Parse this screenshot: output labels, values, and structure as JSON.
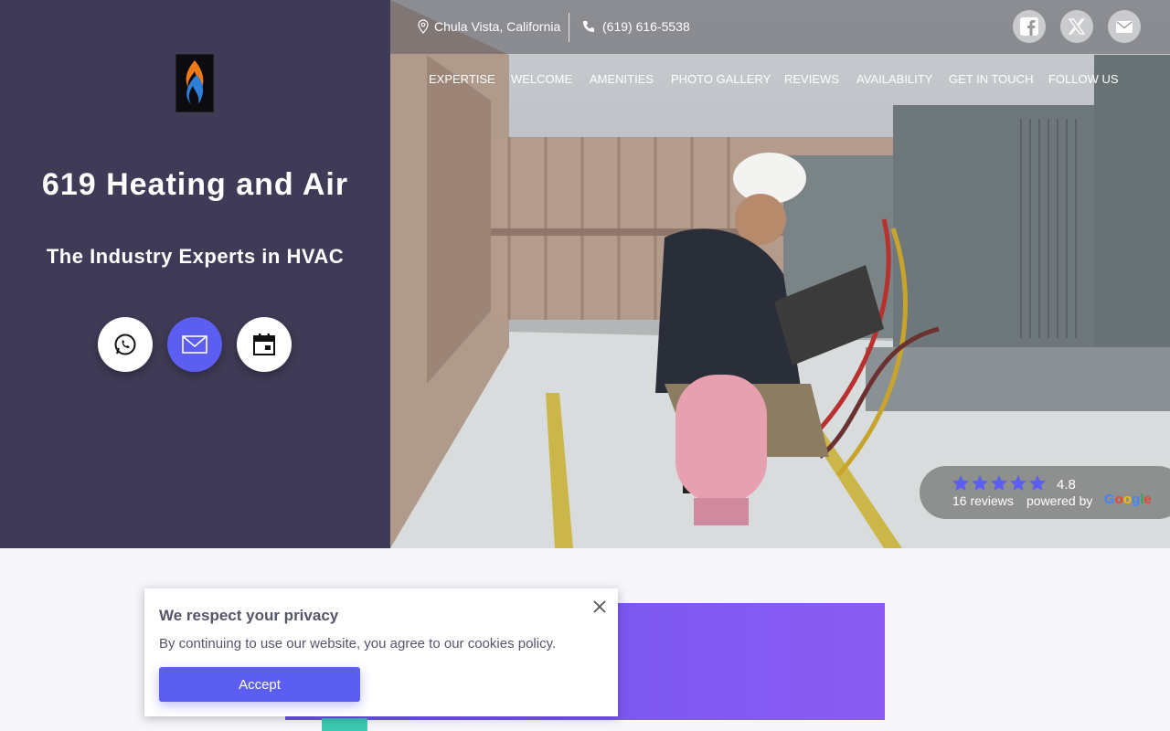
{
  "brand": {
    "title": "619 Heating and Air",
    "tagline": "The Industry Experts in HVAC",
    "logo_icon": "flame-logo-icon"
  },
  "actions": [
    {
      "icon": "whatsapp-icon"
    },
    {
      "icon": "mail-icon"
    },
    {
      "icon": "calendar-icon"
    }
  ],
  "topbar": {
    "location": "Chula Vista, California",
    "phone": "(619) 616-5538",
    "social": [
      {
        "icon": "facebook-icon"
      },
      {
        "icon": "x-twitter-icon"
      },
      {
        "icon": "mail-icon"
      }
    ]
  },
  "nav": [
    "EXPERTISE",
    "WELCOME",
    "AMENITIES",
    "PHOTO GALLERY",
    "REVIEWS",
    "AVAILABILITY",
    "GET IN TOUCH",
    "FOLLOW US"
  ],
  "reviews": {
    "rating": "4.8",
    "count": "16 reviews",
    "powered": "powered by",
    "provider": "Google",
    "stars": 5
  },
  "cookie": {
    "title": "We respect your privacy",
    "text": "By continuing to use our website, you agree to our cookies policy.",
    "accept": "Accept"
  },
  "colors": {
    "panel": "#3f3b57",
    "accent": "#5b5ef0",
    "teal": "#3cc8b0"
  }
}
